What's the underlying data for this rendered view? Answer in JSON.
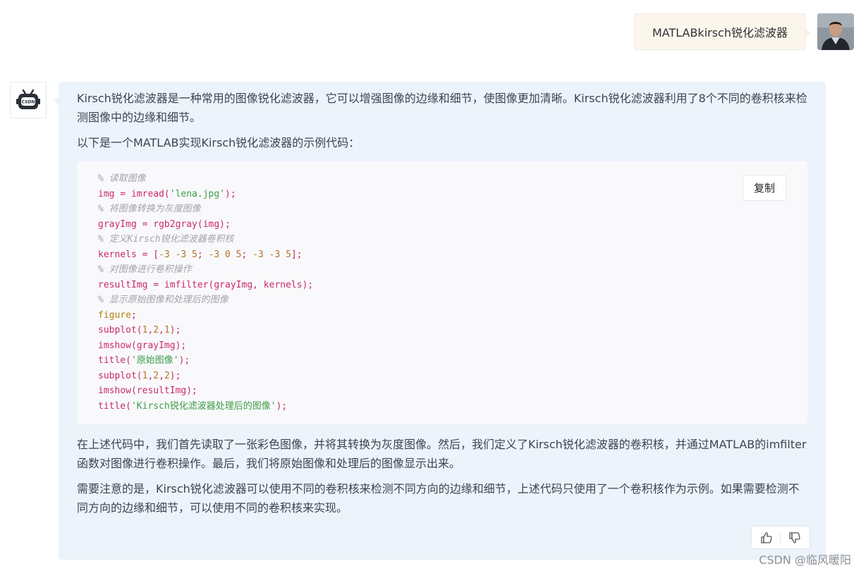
{
  "user_message": {
    "text": "MATLABkirsch锐化滤波器"
  },
  "bot_avatar": {
    "logo_text": "CSDN"
  },
  "bot_message": {
    "intro": "Kirsch锐化滤波器是一种常用的图像锐化滤波器，它可以增强图像的边缘和细节，使图像更加清晰。Kirsch锐化滤波器利用了8个不同的卷积核来检测图像中的边缘和细节。",
    "code_intro": "以下是一个MATLAB实现Kirsch锐化滤波器的示例代码：",
    "copy_label": "复制",
    "code_lines": [
      [
        {
          "t": "% 读取图像",
          "c": "comment"
        }
      ],
      [
        {
          "t": "img = imread(",
          "c": "code"
        },
        {
          "t": "'lena.jpg'",
          "c": "str"
        },
        {
          "t": ");",
          "c": "code"
        }
      ],
      [
        {
          "t": "% 将图像转换为灰度图像",
          "c": "comment"
        }
      ],
      [
        {
          "t": "grayImg = rgb2gray(img);",
          "c": "code"
        }
      ],
      [
        {
          "t": "% 定义Kirsch锐化滤波器卷积核",
          "c": "comment"
        }
      ],
      [
        {
          "t": "kernels = [",
          "c": "code"
        },
        {
          "t": "-3 -3 5",
          "c": "num"
        },
        {
          "t": "; ",
          "c": "code"
        },
        {
          "t": "-3 0 5",
          "c": "num"
        },
        {
          "t": "; ",
          "c": "code"
        },
        {
          "t": "-3 -3 5",
          "c": "num"
        },
        {
          "t": "];",
          "c": "code"
        }
      ],
      [
        {
          "t": "% 对图像进行卷积操作",
          "c": "comment"
        }
      ],
      [
        {
          "t": "resultImg = imfilter(grayImg, kernels);",
          "c": "code"
        }
      ],
      [
        {
          "t": "% 显示原始图像和处理后的图像",
          "c": "comment"
        }
      ],
      [
        {
          "t": "figure",
          "c": "kw"
        },
        {
          "t": ";",
          "c": "code"
        }
      ],
      [
        {
          "t": "subplot(",
          "c": "code"
        },
        {
          "t": "1",
          "c": "num"
        },
        {
          "t": ",",
          "c": "code"
        },
        {
          "t": "2",
          "c": "num"
        },
        {
          "t": ",",
          "c": "code"
        },
        {
          "t": "1",
          "c": "num"
        },
        {
          "t": ");",
          "c": "code"
        }
      ],
      [
        {
          "t": "imshow(grayImg);",
          "c": "code"
        }
      ],
      [
        {
          "t": "title(",
          "c": "code"
        },
        {
          "t": "'原始图像'",
          "c": "str"
        },
        {
          "t": ");",
          "c": "code"
        }
      ],
      [
        {
          "t": "subplot(",
          "c": "code"
        },
        {
          "t": "1",
          "c": "num"
        },
        {
          "t": ",",
          "c": "code"
        },
        {
          "t": "2",
          "c": "num"
        },
        {
          "t": ",",
          "c": "code"
        },
        {
          "t": "2",
          "c": "num"
        },
        {
          "t": ");",
          "c": "code"
        }
      ],
      [
        {
          "t": "imshow(resultImg);",
          "c": "code"
        }
      ],
      [
        {
          "t": "title(",
          "c": "code"
        },
        {
          "t": "'Kirsch锐化滤波器处理后的图像'",
          "c": "str"
        },
        {
          "t": ");",
          "c": "code"
        }
      ]
    ],
    "explanation": "在上述代码中，我们首先读取了一张彩色图像，并将其转换为灰度图像。然后，我们定义了Kirsch锐化滤波器的卷积核，并通过MATLAB的imfilter函数对图像进行卷积操作。最后，我们将原始图像和处理后的图像显示出来。",
    "note": "需要注意的是，Kirsch锐化滤波器可以使用不同的卷积核来检测不同方向的边缘和细节，上述代码只使用了一个卷积核作为示例。如果需要检测不同方向的边缘和细节，可以使用不同的卷积核来实现。"
  },
  "watermark": "CSDN @临风暖阳",
  "colors": {
    "user_bubble": "#faf6ec",
    "bot_bubble": "#edf3fb",
    "code_bg": "#f9f9fb",
    "code_comment": "#a0a4ab",
    "code_text": "#c92c67",
    "code_string": "#3c9c4a",
    "code_number": "#b2752d"
  },
  "icons": {
    "thumbs_up": "thumbs-up-icon",
    "thumbs_down": "thumbs-down-icon"
  }
}
